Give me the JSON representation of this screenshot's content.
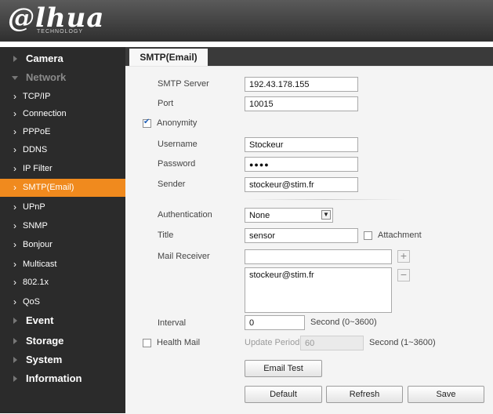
{
  "brand": {
    "logo_text": "@lhua",
    "logo_sub": "TECHNOLOGY"
  },
  "sidebar": {
    "items": [
      {
        "label": "Camera",
        "level": "top",
        "expanded": false
      },
      {
        "label": "Network",
        "level": "top",
        "expanded": true
      },
      {
        "label": "TCP/IP",
        "level": "sub"
      },
      {
        "label": "Connection",
        "level": "sub"
      },
      {
        "label": "PPPoE",
        "level": "sub"
      },
      {
        "label": "DDNS",
        "level": "sub"
      },
      {
        "label": "IP Filter",
        "level": "sub"
      },
      {
        "label": "SMTP(Email)",
        "level": "sub",
        "active": true
      },
      {
        "label": "UPnP",
        "level": "sub"
      },
      {
        "label": "SNMP",
        "level": "sub"
      },
      {
        "label": "Bonjour",
        "level": "sub"
      },
      {
        "label": "Multicast",
        "level": "sub"
      },
      {
        "label": "802.1x",
        "level": "sub"
      },
      {
        "label": "QoS",
        "level": "sub"
      },
      {
        "label": "Event",
        "level": "top",
        "expanded": false
      },
      {
        "label": "Storage",
        "level": "top",
        "expanded": false
      },
      {
        "label": "System",
        "level": "top",
        "expanded": false
      },
      {
        "label": "Information",
        "level": "top",
        "expanded": false
      }
    ]
  },
  "tab": {
    "label": "SMTP(Email)"
  },
  "form": {
    "smtp_server": {
      "label": "SMTP Server",
      "value": "192.43.178.155"
    },
    "port": {
      "label": "Port",
      "value": "10015"
    },
    "anonymity": {
      "label": "Anonymity",
      "checked": true
    },
    "username": {
      "label": "Username",
      "value": "Stockeur"
    },
    "password": {
      "label": "Password",
      "value": "●●●●"
    },
    "sender": {
      "label": "Sender",
      "value": "stockeur@stim.fr"
    },
    "authentication": {
      "label": "Authentication",
      "value": "None"
    },
    "title": {
      "label": "Title",
      "value": "sensor"
    },
    "attachment": {
      "label": "Attachment",
      "checked": false
    },
    "mail_receiver": {
      "label": "Mail Receiver",
      "value": "",
      "list": [
        "stockeur@stim.fr"
      ]
    },
    "interval": {
      "label": "Interval",
      "value": "0",
      "unit": "Second (0~3600)"
    },
    "health_mail": {
      "label": "Health Mail",
      "checked": false
    },
    "update_period": {
      "label": "Update Period",
      "value": "60",
      "unit": "Second (1~3600)"
    }
  },
  "buttons": {
    "email_test": "Email Test",
    "default": "Default",
    "refresh": "Refresh",
    "save": "Save"
  },
  "icons": {
    "add": "+",
    "remove": "−",
    "dropdown": "▼"
  },
  "colors": {
    "accent": "#f08a1e",
    "sidebar_bg": "#2b2b2b",
    "check": "#1e5eb5"
  }
}
